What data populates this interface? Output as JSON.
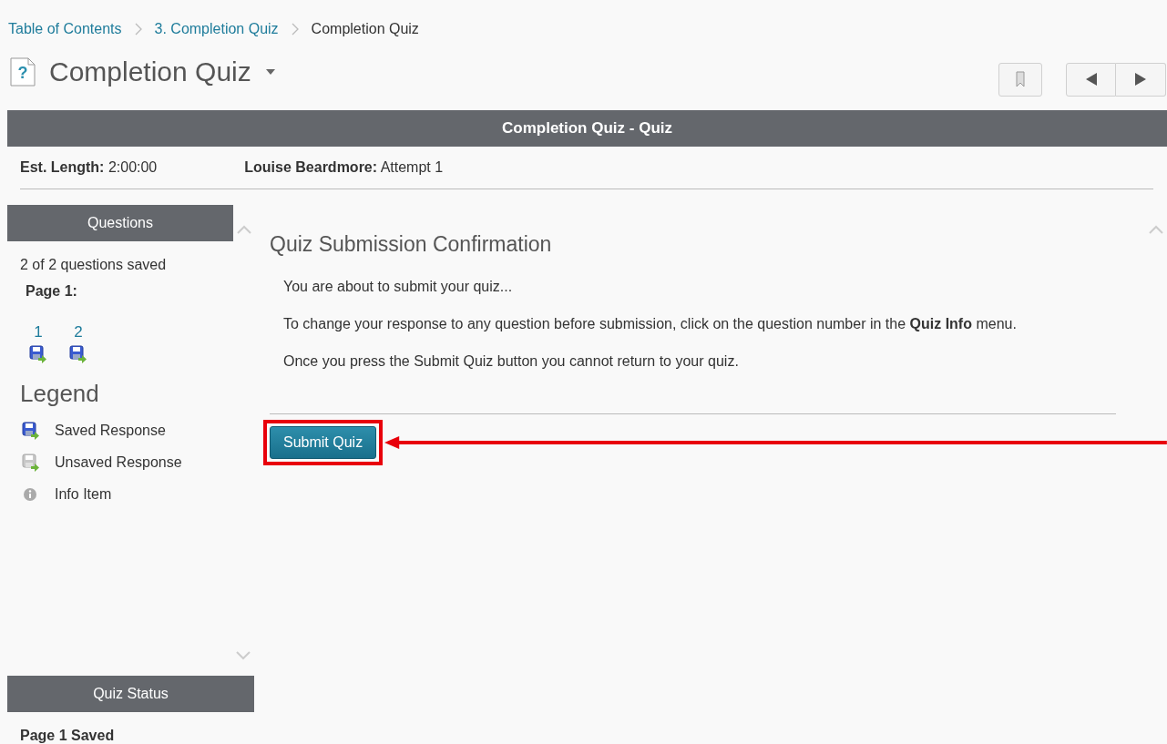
{
  "breadcrumb": [
    {
      "label": "Table of Contents",
      "link": true
    },
    {
      "label": "3. Completion Quiz",
      "link": true
    },
    {
      "label": "Completion Quiz",
      "link": false
    }
  ],
  "title_icon": "?",
  "title": "Completion Quiz",
  "banner": "Completion Quiz - Quiz",
  "info": [
    {
      "label": "Est. Length:",
      "value": "2:00:00"
    },
    {
      "label": "Louise Beardmore:",
      "value": "Attempt 1"
    }
  ],
  "sidebar": {
    "header": "Questions",
    "summary": "2 of 2 questions saved",
    "page_label": "Page 1:",
    "questions": [
      {
        "number": "1",
        "saved": true
      },
      {
        "number": "2",
        "saved": true
      }
    ],
    "legend_title": "Legend",
    "legend": [
      {
        "kind": "saved",
        "label": "Saved Response"
      },
      {
        "kind": "unsaved",
        "label": "Unsaved Response"
      },
      {
        "kind": "info",
        "label": "Info Item"
      }
    ],
    "status_header": "Quiz Status",
    "status": "Page 1 Saved"
  },
  "main": {
    "heading": "Quiz Submission Confirmation",
    "paragraphs": [
      "You are about to submit your quiz...",
      "To change your response to any question before submission, click on the question number in the **Quiz Info** menu.",
      "Once you press the Submit Quiz button you cannot return to your quiz."
    ],
    "submit_button": "Submit Quiz"
  }
}
